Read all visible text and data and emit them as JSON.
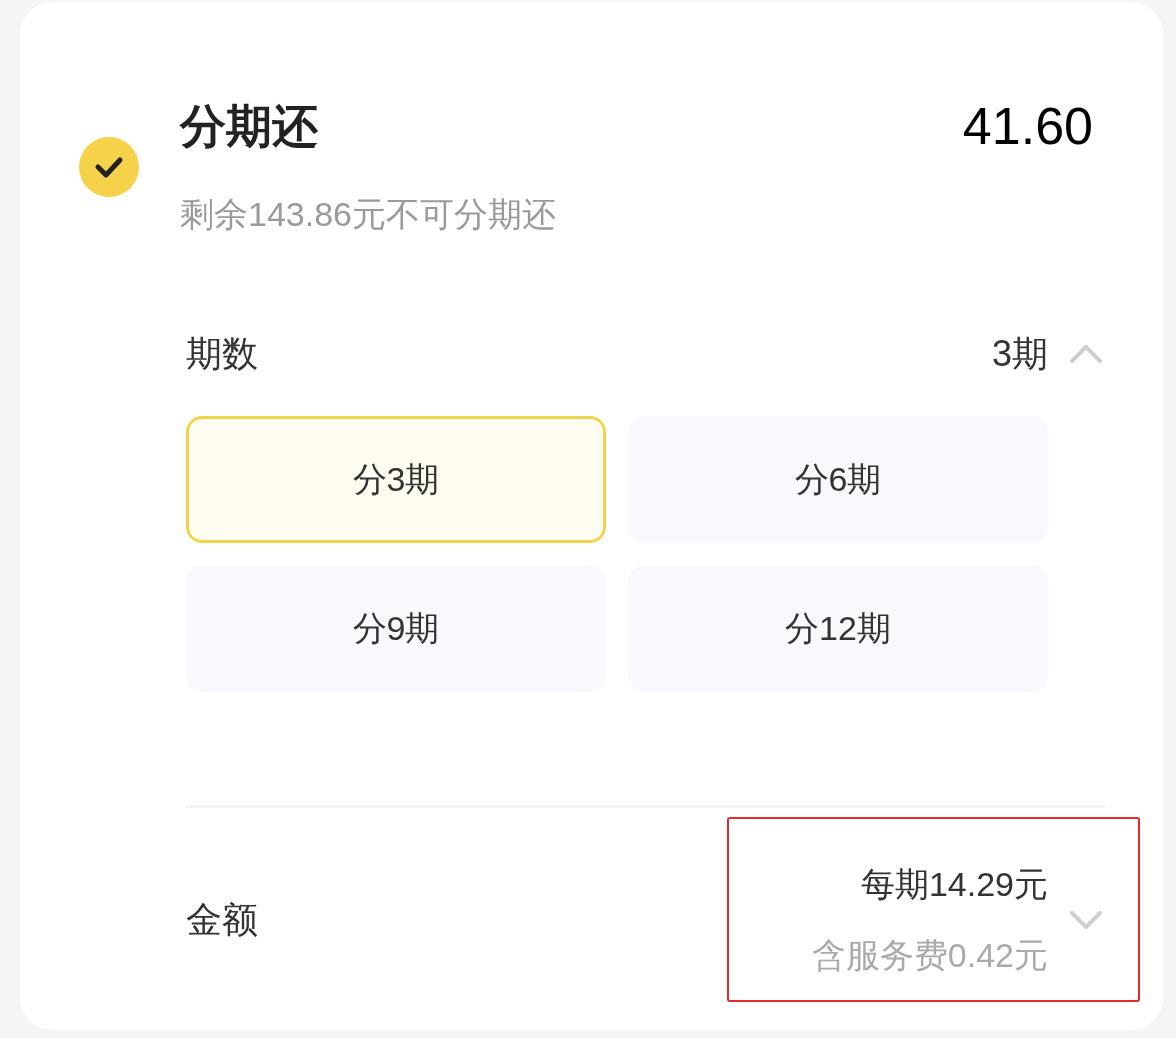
{
  "option": {
    "checked": true,
    "title": "分期还",
    "amount": "41.60",
    "note": "剩余143.86元不可分期还"
  },
  "installments": {
    "label": "期数",
    "value": "3期",
    "expanded": true,
    "options": [
      {
        "label": "分3期",
        "selected": true
      },
      {
        "label": "分6期",
        "selected": false
      },
      {
        "label": "分9期",
        "selected": false
      },
      {
        "label": "分12期",
        "selected": false
      }
    ]
  },
  "amount_row": {
    "label": "金额",
    "per_period": "每期14.29元",
    "fee": "含服务费0.42元",
    "expanded": false
  }
}
